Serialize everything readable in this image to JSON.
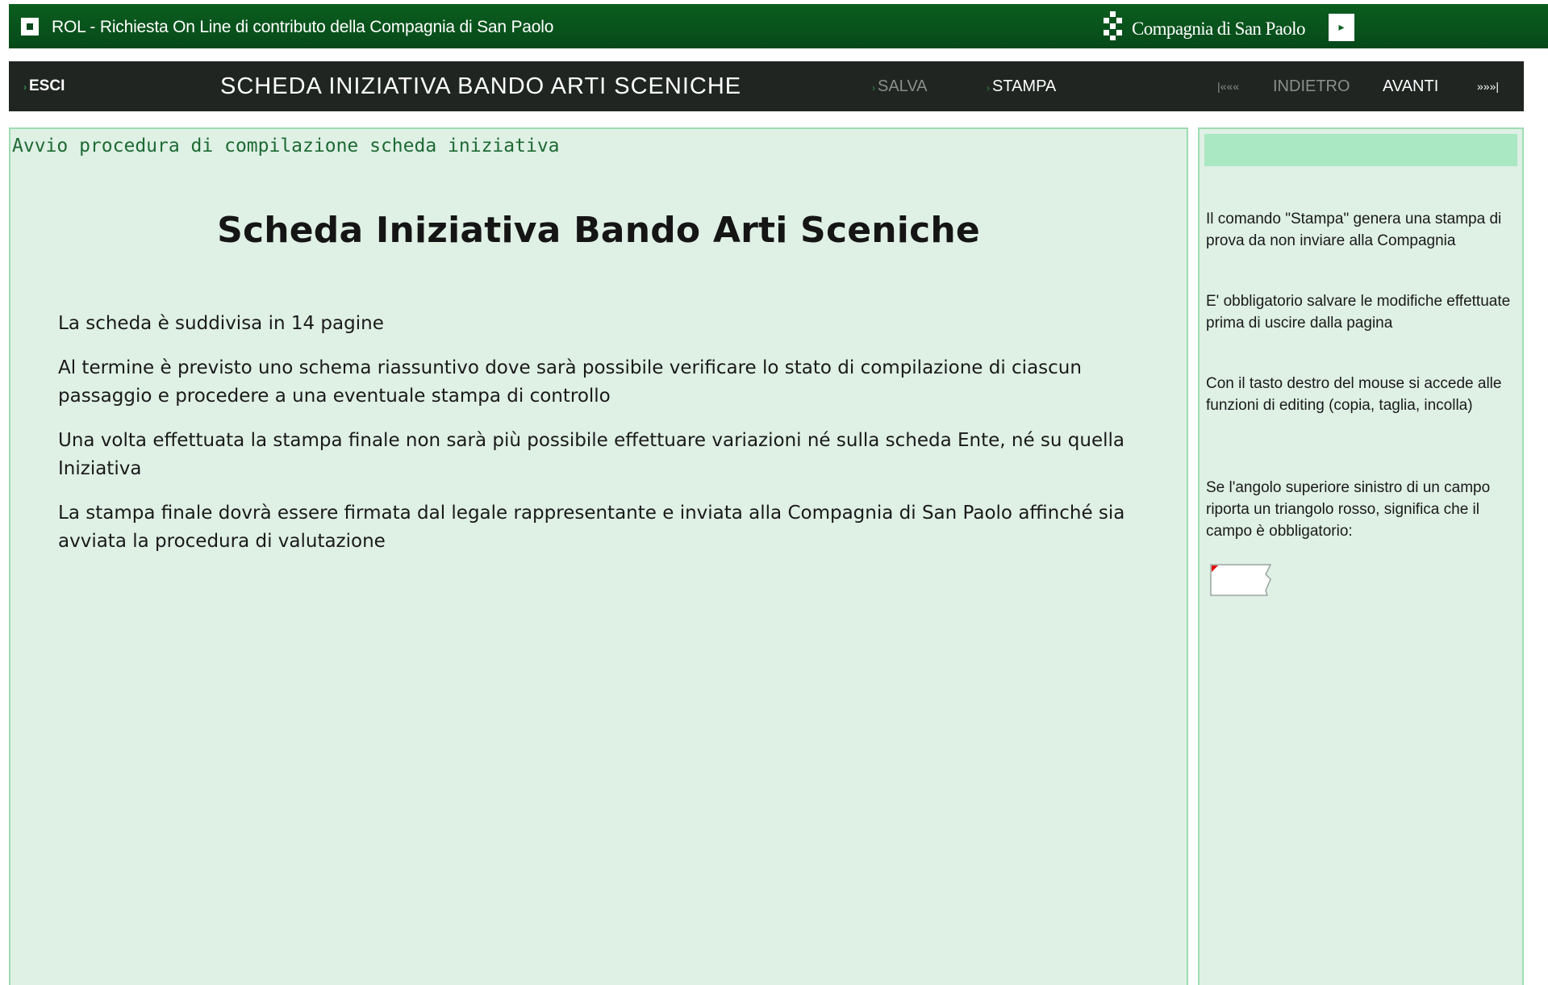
{
  "header": {
    "app_title": "ROL - Richiesta On Line di contributo della Compagnia di San Paolo",
    "brand_name": "Compagnia di San Paolo",
    "app_icon": "square-icon",
    "brand_icon": "compagnia-logo-icon",
    "arrow_icon": "arrow-right-icon",
    "bg_color": "#0b5e1f"
  },
  "toolbar": {
    "esci_label": "ESCI",
    "page_heading": "SCHEDA INIZIATIVA BANDO ARTI SCENICHE",
    "salva_label": "SALVA",
    "stampa_label": "STAMPA",
    "first_label": "|«««",
    "indietro_label": "INDIETRO",
    "avanti_label": "AVANTI",
    "last_label": "»»»|",
    "bg_color": "#202522",
    "disabled_color": "#8a8f8c"
  },
  "main": {
    "breadcrumb": "Avvio procedura di compilazione scheda iniziativa",
    "title": "Scheda Iniziativa Bando Arti Sceniche",
    "paragraphs": [
      "La scheda è suddivisa in 14 pagine",
      "Al termine è previsto uno schema riassuntivo dove sarà possibile verificare lo stato di compilazione di ciascun passaggio e procedere a una eventuale stampa di controllo",
      "Una volta effettuata la stampa finale non sarà più possibile effettuare variazioni né sulla scheda Ente, né su quella Iniziativa",
      "La stampa finale dovrà essere firmata dal legale rappresentante e inviata alla Compagnia di San Paolo affinché sia avviata la procedura di valutazione"
    ],
    "bg_color": "#dff0e5"
  },
  "side": {
    "tips": [
      "Il comando \"Stampa\" genera una stampa di prova da non inviare alla Compagnia",
      "E' obbligatorio salvare le modifiche effettuate prima di uscire dalla pagina",
      "Con il tasto destro del mouse si accede alle funzioni di editing (copia, taglia, incolla)",
      " Se l'angolo superiore sinistro di un campo riporta un triangolo rosso, significa che il campo è obbligatorio:"
    ],
    "sample_icon": "required-field-sample-icon",
    "header_color": "#a9e8c3"
  }
}
